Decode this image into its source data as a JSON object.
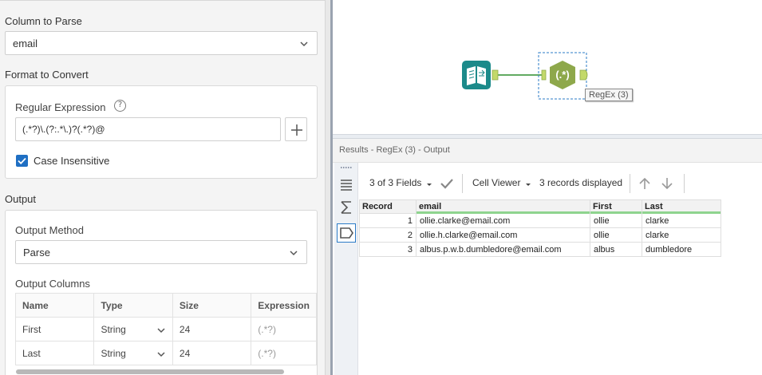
{
  "config": {
    "column_to_parse": {
      "label": "Column to Parse",
      "value": "email"
    },
    "format_to_convert": {
      "label": "Format to Convert"
    },
    "regex": {
      "label": "Regular Expression",
      "help_icon": "?",
      "value": "(.*?)\\.(?:.*\\.)?(.*?)@",
      "case_insensitive_label": "Case Insensitive",
      "case_insensitive": true
    },
    "output": {
      "label": "Output",
      "method_label": "Output Method",
      "method_value": "Parse",
      "columns_label": "Output Columns",
      "headers": [
        "Name",
        "Type",
        "Size",
        "Expression"
      ],
      "rows": [
        {
          "name": "First",
          "type": "String",
          "size": "24",
          "expression": "(.*?)"
        },
        {
          "name": "Last",
          "type": "String",
          "size": "24",
          "expression": "(.*?)"
        }
      ]
    }
  },
  "canvas": {
    "input_tool_icon": "book-input-icon",
    "regex_tool_icon": "regex-tool-icon",
    "regex_tool_glyph": "(.*)",
    "regex_tool_tag": "RegEx (3)"
  },
  "results": {
    "title": "Results - RegEx (3) - Output",
    "fields_label": "3 of 3 Fields",
    "viewer_label": "Cell Viewer",
    "records_label": "3 records displayed",
    "headers": [
      "Record",
      "email",
      "First",
      "Last"
    ],
    "rows": [
      {
        "record": "1",
        "email": "ollie.clarke@email.com",
        "first": "ollie",
        "last": "clarke"
      },
      {
        "record": "2",
        "email": "ollie.h.clarke@email.com",
        "first": "ollie",
        "last": "clarke"
      },
      {
        "record": "3",
        "email": "albus.p.w.b.dumbledore@email.com",
        "first": "albus",
        "last": "dumbledore"
      }
    ]
  },
  "colors": {
    "accent": "#1f6fc3",
    "input_tool": "#1c8a8a",
    "regex_tool": "#8ea84b",
    "new_field_bar": "#8fd48f"
  }
}
